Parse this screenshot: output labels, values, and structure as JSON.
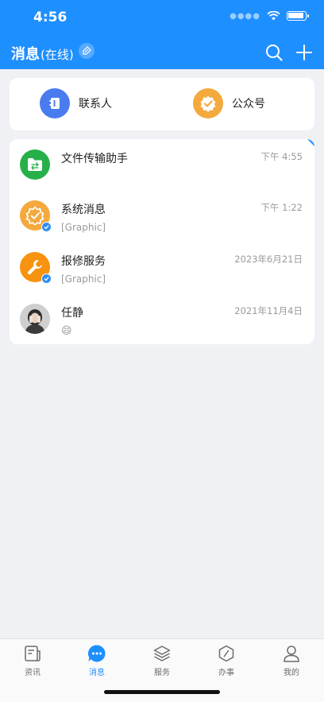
{
  "status_bar": {
    "time": "4:56"
  },
  "header": {
    "title": "消息",
    "status": "(在线)"
  },
  "quick_links": [
    {
      "label": "联系人",
      "icon": "contacts-icon",
      "color": "#4a7cf0"
    },
    {
      "label": "公众号",
      "icon": "verified-badge-icon",
      "color": "#f4a93d"
    }
  ],
  "chats": [
    {
      "name": "文件传输助手",
      "time": "下午 4:55",
      "preview": "",
      "icon": "folder-transfer-icon",
      "color": "#27b04a"
    },
    {
      "name": "系统消息",
      "time": "下午 1:22",
      "preview": "[Graphic]",
      "icon": "system-badge-icon",
      "color": "#f4a93d"
    },
    {
      "name": "报修服务",
      "time": "2023年6月21日",
      "preview": "[Graphic]",
      "icon": "wrench-icon",
      "color": "#f7930f"
    },
    {
      "name": "任静",
      "time": "2021年11月4日",
      "preview": "😄",
      "icon": "user-photo",
      "color": "#6a6a6a"
    }
  ],
  "tabs": [
    {
      "label": "资讯",
      "icon": "news-icon"
    },
    {
      "label": "消息",
      "icon": "message-icon",
      "active": true
    },
    {
      "label": "服务",
      "icon": "layers-icon"
    },
    {
      "label": "办事",
      "icon": "compass-icon"
    },
    {
      "label": "我的",
      "icon": "profile-icon"
    }
  ],
  "colors": {
    "primary": "#1e8fff",
    "background": "#f0f1f5"
  }
}
